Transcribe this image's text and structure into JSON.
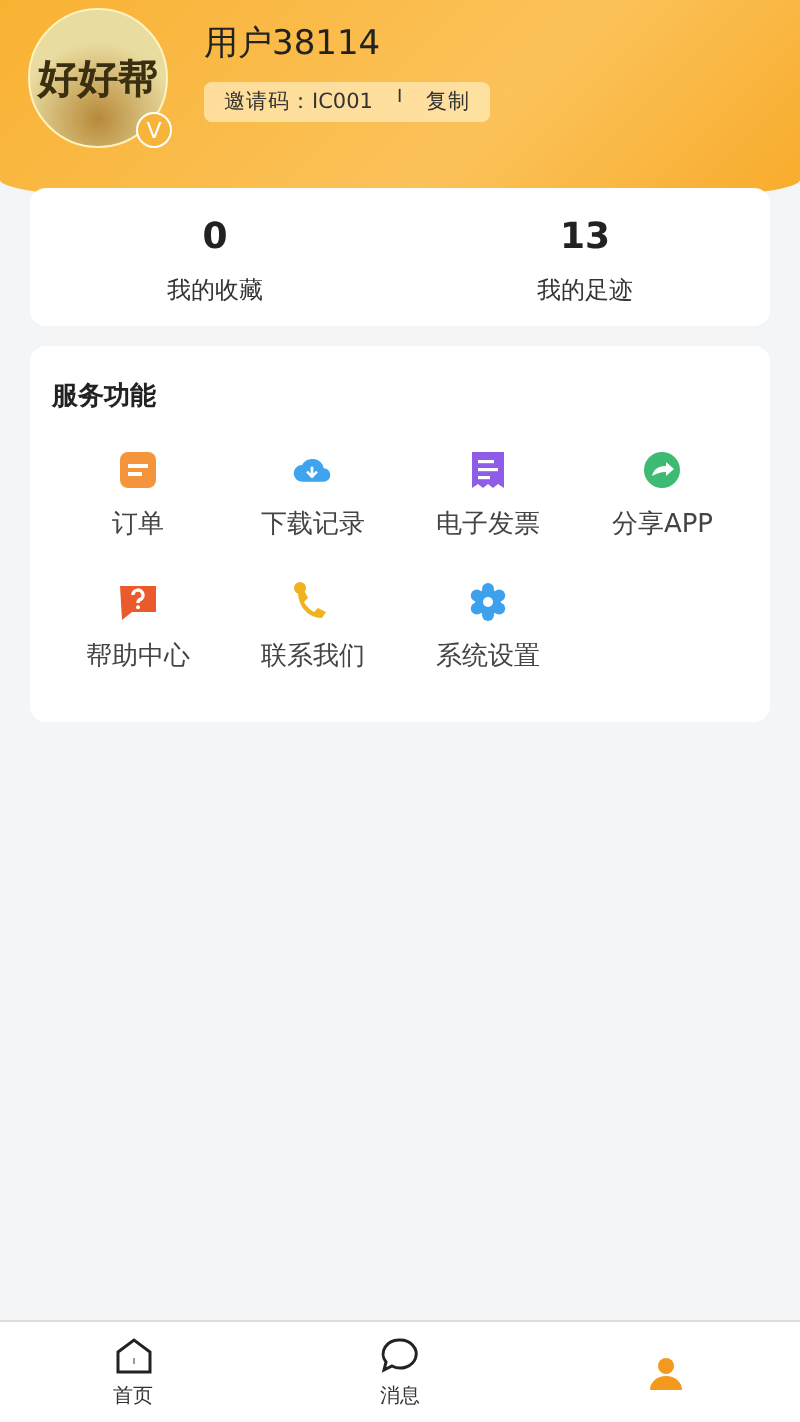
{
  "profile": {
    "avatar_text": "好好帮",
    "badge": "V",
    "username": "用户38114",
    "invite_label": "邀请码：IC001",
    "separator": "I",
    "copy": "复制"
  },
  "stats": [
    {
      "value": "0",
      "label": "我的收藏"
    },
    {
      "value": "13",
      "label": "我的足迹"
    }
  ],
  "services": {
    "title": "服务功能",
    "items": [
      {
        "kind": "order",
        "label": "订单"
      },
      {
        "kind": "download",
        "label": "下载记录"
      },
      {
        "kind": "invoice",
        "label": "电子发票"
      },
      {
        "kind": "share",
        "label": "分享APP"
      },
      {
        "kind": "help",
        "label": "帮助中心"
      },
      {
        "kind": "contact",
        "label": "联系我们"
      },
      {
        "kind": "settings",
        "label": "系统设置"
      }
    ]
  },
  "tab_bar": [
    {
      "kind": "home",
      "label": "首页",
      "selected": false
    },
    {
      "kind": "message",
      "label": "消息",
      "selected": false
    },
    {
      "kind": "me",
      "selected": true
    }
  ]
}
